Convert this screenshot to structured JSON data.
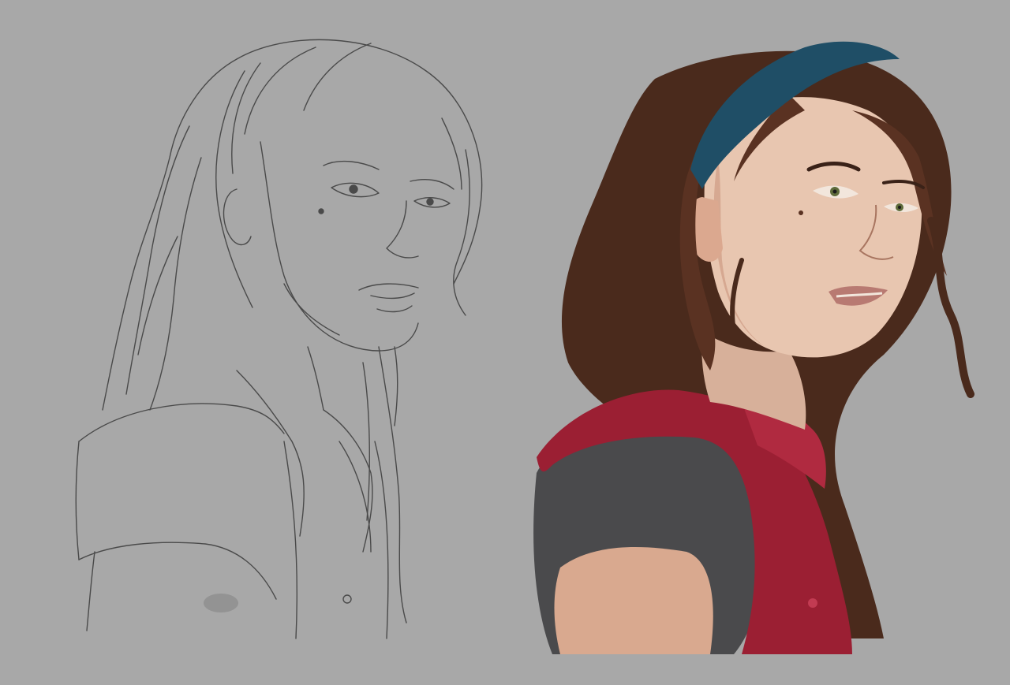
{
  "canvas": {
    "background": "#a9a9a9"
  },
  "artworks": [
    {
      "kind": "pencil-sketch",
      "subject": "woman-portrait",
      "stroke_color": "#3a3a3a"
    },
    {
      "kind": "colored-painting",
      "subject": "woman-portrait",
      "colors": {
        "hair": "#4a2a1c",
        "headband": "#1f4e66",
        "skin": "#e8c6b0",
        "vest": "#9b1f33",
        "shirt": "#4a4a4c",
        "eyes": "#5e6b3a"
      }
    }
  ]
}
